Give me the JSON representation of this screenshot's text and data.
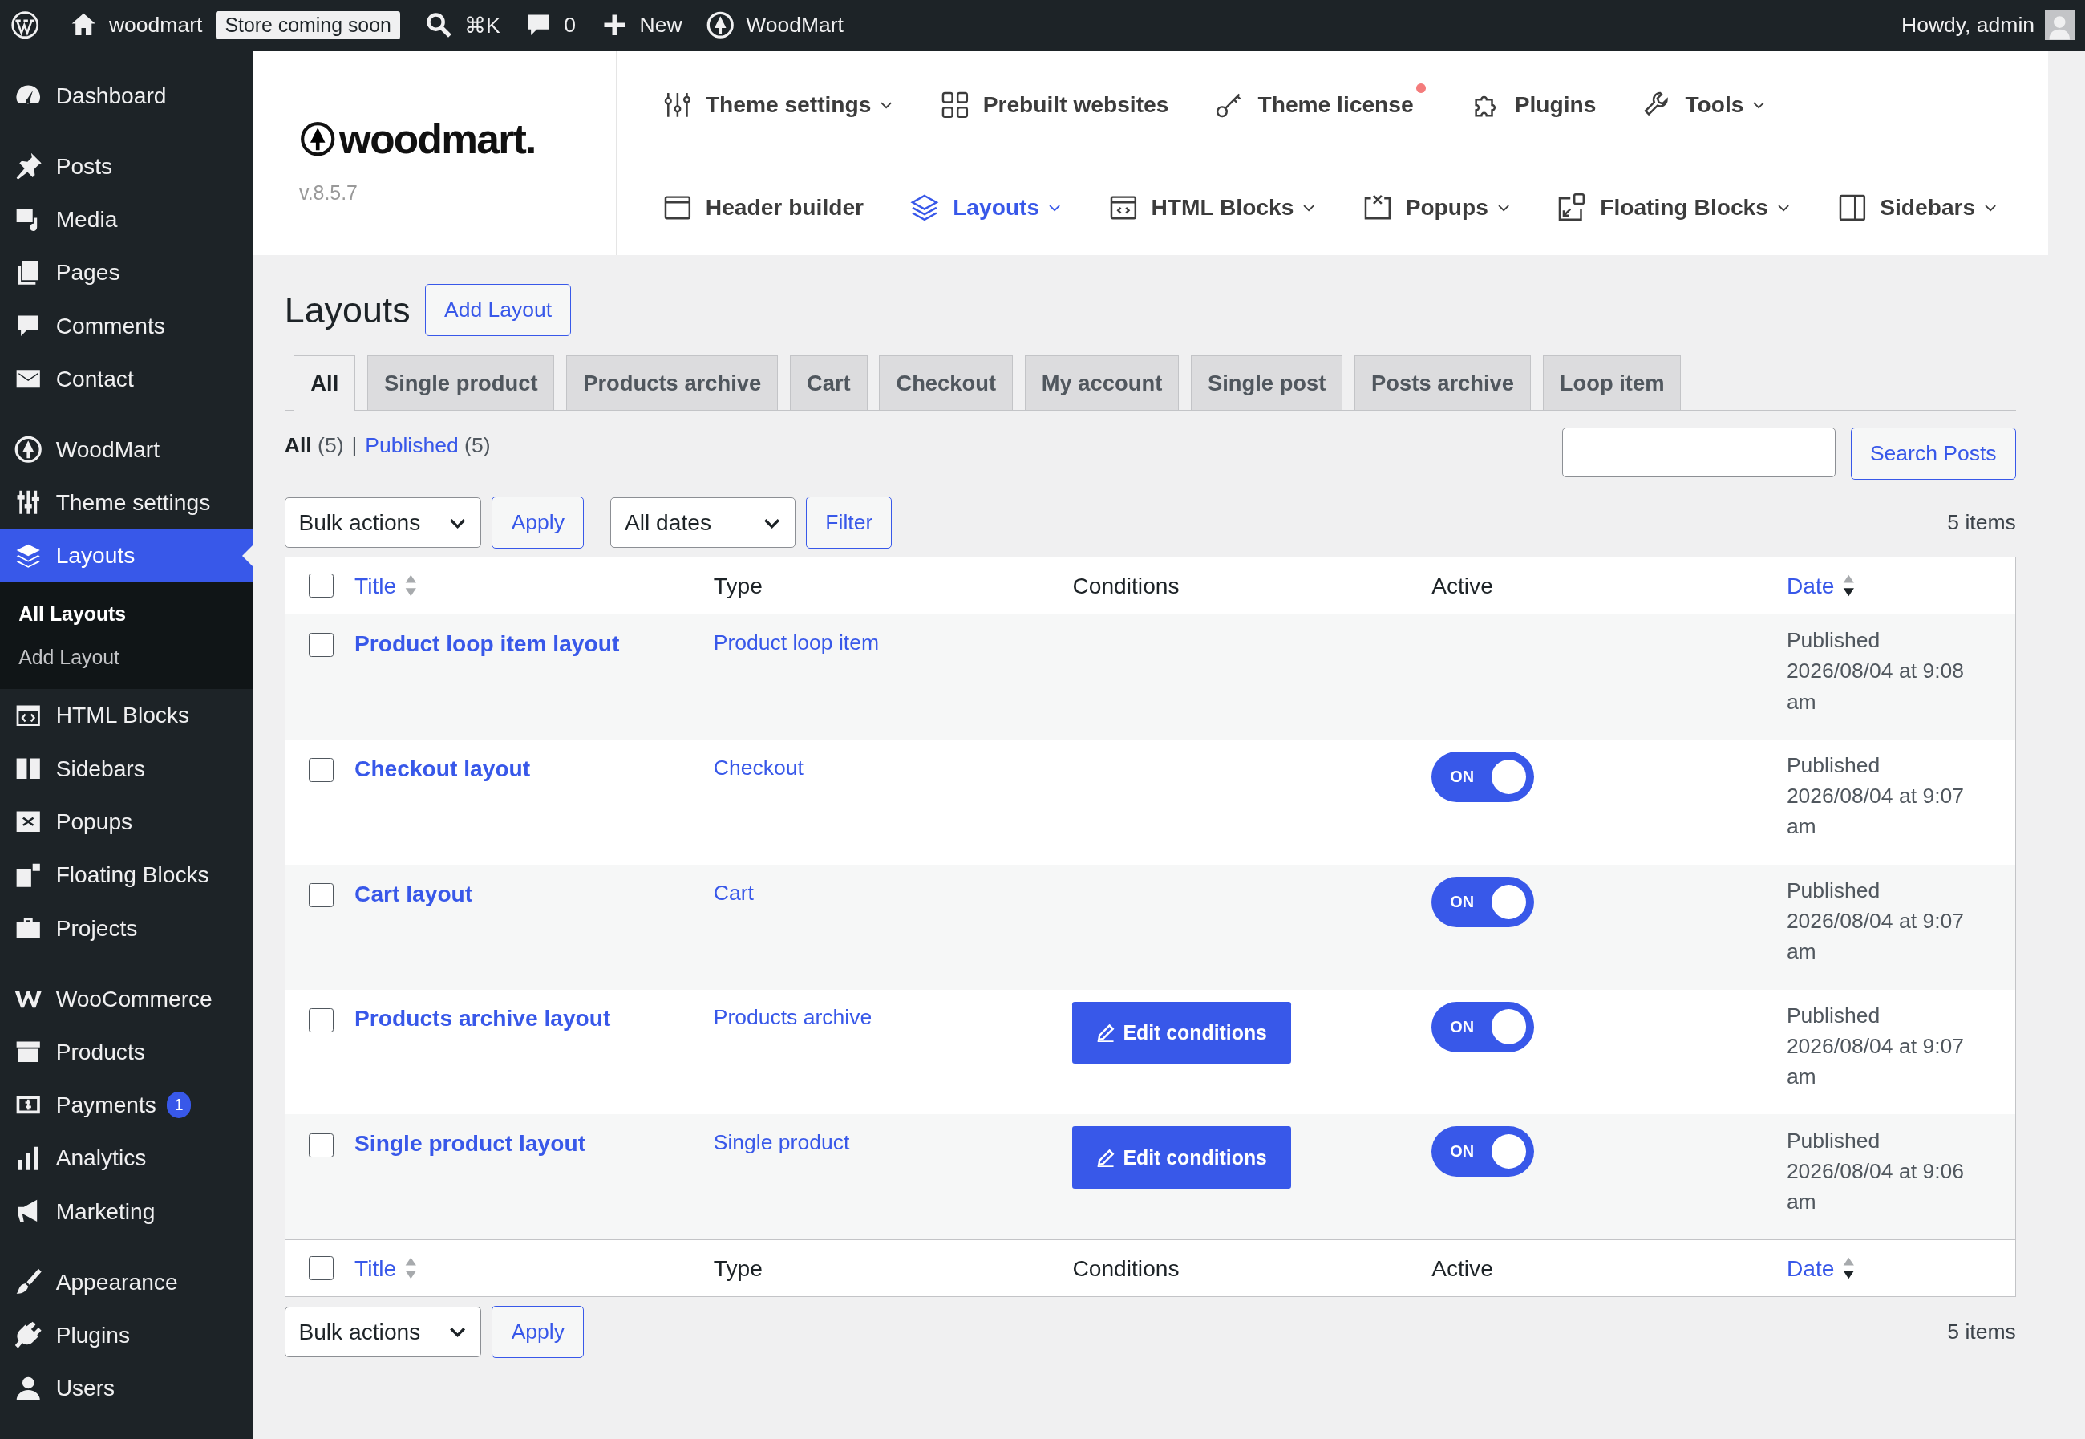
{
  "admin_bar": {
    "site": "woodmart",
    "badge": "Store coming soon",
    "shortcut": "⌘K",
    "comments": "0",
    "new": "New",
    "theme": "WoodMart",
    "greeting": "Howdy, admin"
  },
  "sidebar": {
    "sections": [
      {
        "items": [
          {
            "label": "Dashboard",
            "selected": false
          }
        ]
      },
      {
        "items": [
          {
            "label": "Posts",
            "selected": false
          },
          {
            "label": "Media",
            "selected": false
          },
          {
            "label": "Pages",
            "selected": false
          },
          {
            "label": "Comments",
            "selected": false
          },
          {
            "label": "Contact",
            "selected": false
          }
        ]
      },
      {
        "items": [
          {
            "label": "WoodMart",
            "selected": false
          },
          {
            "label": "Theme settings",
            "selected": false
          },
          {
            "label": "Layouts",
            "selected": true,
            "children": [
              {
                "label": "All Layouts",
                "selected": true
              },
              {
                "label": "Add Layout",
                "selected": false
              }
            ]
          },
          {
            "label": "HTML Blocks",
            "selected": false
          },
          {
            "label": "Sidebars",
            "selected": false
          },
          {
            "label": "Popups",
            "selected": false
          },
          {
            "label": "Floating Blocks",
            "selected": false
          },
          {
            "label": "Projects",
            "selected": false
          }
        ]
      },
      {
        "items": [
          {
            "label": "WooCommerce",
            "selected": false
          },
          {
            "label": "Products",
            "selected": false
          },
          {
            "label": "Payments",
            "selected": false,
            "badge": "1"
          },
          {
            "label": "Analytics",
            "selected": false
          },
          {
            "label": "Marketing",
            "selected": false
          }
        ]
      },
      {
        "items": [
          {
            "label": "Appearance",
            "selected": false
          },
          {
            "label": "Plugins",
            "selected": false
          },
          {
            "label": "Users",
            "selected": false
          }
        ]
      }
    ]
  },
  "theme_header": {
    "logo": "woodmart.",
    "version": "v.8.5.7",
    "nav_rows": [
      [
        {
          "label": "Theme settings",
          "dropdown": true,
          "selected": false,
          "notification": false
        },
        {
          "label": "Prebuilt websites",
          "dropdown": false,
          "selected": false,
          "notification": false
        },
        {
          "label": "Theme license",
          "dropdown": false,
          "selected": false,
          "notification": true
        },
        {
          "label": "Plugins",
          "dropdown": false,
          "selected": false,
          "notification": false
        },
        {
          "label": "Tools",
          "dropdown": true,
          "selected": false,
          "notification": false
        }
      ],
      [
        {
          "label": "Header builder",
          "dropdown": false,
          "selected": false,
          "notification": false
        },
        {
          "label": "Layouts",
          "dropdown": true,
          "selected": true,
          "notification": false
        },
        {
          "label": "HTML Blocks",
          "dropdown": true,
          "selected": false,
          "notification": false
        },
        {
          "label": "Popups",
          "dropdown": true,
          "selected": false,
          "notification": false
        },
        {
          "label": "Floating Blocks",
          "dropdown": true,
          "selected": false,
          "notification": false
        },
        {
          "label": "Sidebars",
          "dropdown": true,
          "selected": false,
          "notification": false
        }
      ]
    ]
  },
  "page": {
    "title": "Layouts",
    "add_button": "Add Layout"
  },
  "tabs": [
    {
      "label": "All",
      "selected": true
    },
    {
      "label": "Single product",
      "selected": false
    },
    {
      "label": "Products archive",
      "selected": false
    },
    {
      "label": "Cart",
      "selected": false
    },
    {
      "label": "Checkout",
      "selected": false
    },
    {
      "label": "My account",
      "selected": false
    },
    {
      "label": "Single post",
      "selected": false
    },
    {
      "label": "Posts archive",
      "selected": false
    },
    {
      "label": "Loop item",
      "selected": false
    }
  ],
  "views": {
    "separator": "|",
    "items": [
      {
        "label": "All",
        "count": "(5)",
        "selected": true
      },
      {
        "label": "Published",
        "count": "(5)",
        "selected": false
      }
    ]
  },
  "search": {
    "button": "Search Posts"
  },
  "top_actions": {
    "bulk": "Bulk actions",
    "apply": "Apply",
    "dates": "All dates",
    "filter": "Filter",
    "count": "5 items"
  },
  "table": {
    "select_all_checked": false,
    "footer_select_all_checked": false,
    "columns": [
      {
        "label": "Title",
        "sortable": true,
        "sorted": false
      },
      {
        "label": "Type",
        "sortable": false
      },
      {
        "label": "Conditions",
        "sortable": false
      },
      {
        "label": "Active",
        "sortable": false
      },
      {
        "label": "Date",
        "sortable": true,
        "sorted": true
      }
    ],
    "footer_columns": [
      {
        "label": "Title",
        "sortable": true,
        "sorted": false
      },
      {
        "label": "Type",
        "sortable": false
      },
      {
        "label": "Conditions",
        "sortable": false
      },
      {
        "label": "Active",
        "sortable": false
      },
      {
        "label": "Date",
        "sortable": true,
        "sorted": true
      }
    ],
    "rows": [
      {
        "checked": false,
        "title": "Product loop item layout",
        "type": "Product loop item",
        "status": "Published",
        "date": "2026/08/04 at 9:08 am"
      },
      {
        "checked": false,
        "title": "Checkout layout",
        "type": "Checkout",
        "active": true,
        "toggle_label": "ON",
        "status": "Published",
        "date": "2026/08/04 at 9:07 am"
      },
      {
        "checked": false,
        "title": "Cart layout",
        "type": "Cart",
        "active": true,
        "toggle_label": "ON",
        "status": "Published",
        "date": "2026/08/04 at 9:07 am"
      },
      {
        "checked": false,
        "title": "Products archive layout",
        "type": "Products archive",
        "conditions_button": "Edit conditions",
        "active": true,
        "toggle_label": "ON",
        "status": "Published",
        "date": "2026/08/04 at 9:07 am"
      },
      {
        "checked": false,
        "title": "Single product layout",
        "type": "Single product",
        "conditions_button": "Edit conditions",
        "active": true,
        "toggle_label": "ON",
        "status": "Published",
        "date": "2026/08/04 at 9:06 am"
      }
    ]
  },
  "bottom_actions": {
    "bulk": "Bulk actions",
    "apply": "Apply",
    "count": "5 items"
  }
}
